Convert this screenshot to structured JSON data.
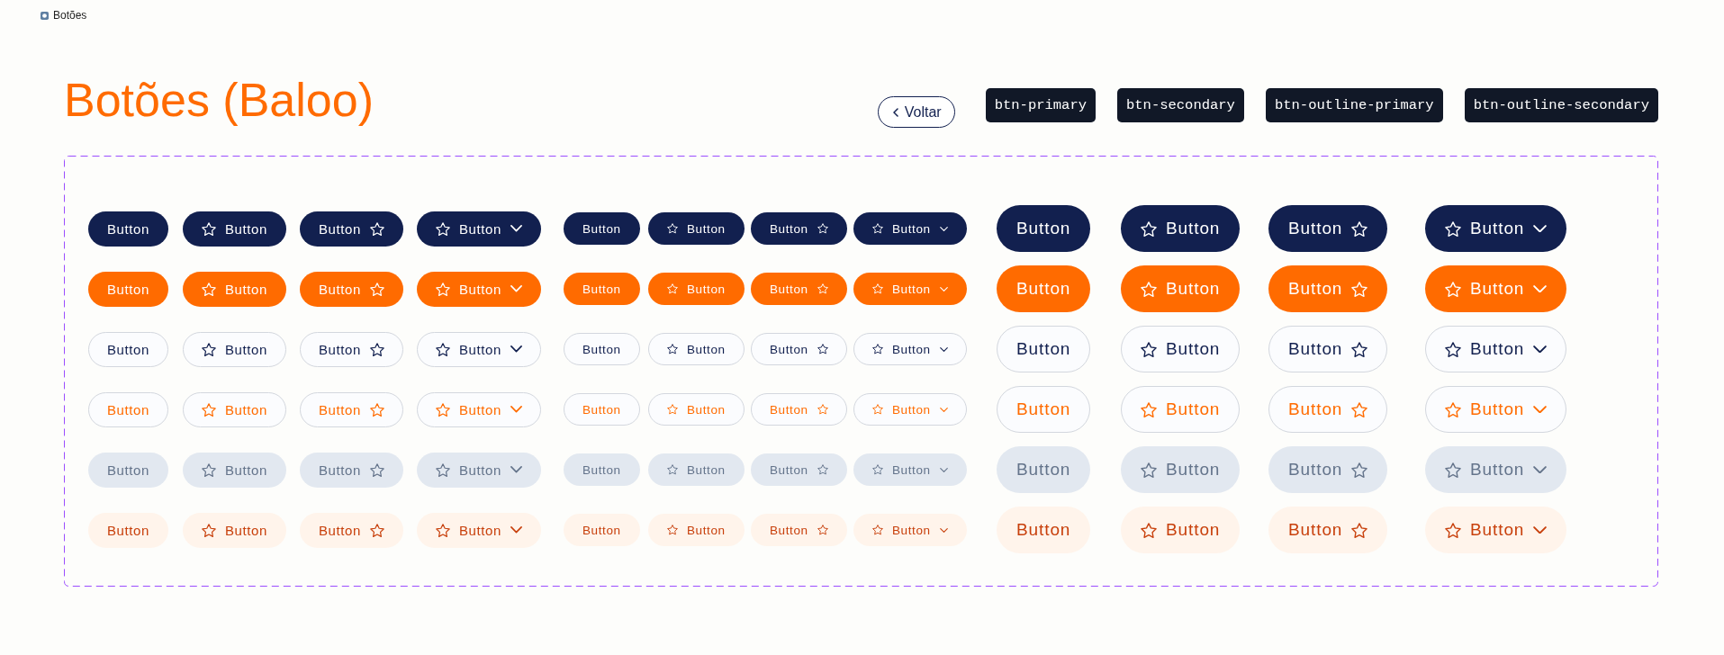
{
  "frame": {
    "title": "Botões"
  },
  "header": {
    "title": "Botões (Baloo)",
    "back_button": {
      "label": "Voltar"
    },
    "class_tags": [
      "btn-primary",
      "btn-secondary",
      "btn-outline-primary",
      "btn-outline-secondary"
    ]
  },
  "button_grid": {
    "rows": [
      {
        "kind": "primary",
        "buttons": [
          {
            "kind": "sm-plain",
            "label": "Button"
          },
          {
            "kind": "sm-icon-left",
            "label": "Button"
          },
          {
            "kind": "sm-icon-right",
            "label": "Button"
          },
          {
            "kind": "sm-dropdown",
            "label": "Button"
          },
          {
            "kind": "xs-plain",
            "label": "Button"
          },
          {
            "kind": "xs-icon-left",
            "label": "Button"
          },
          {
            "kind": "xs-icon-right",
            "label": "Button"
          },
          {
            "kind": "xs-dropdown",
            "label": "Button"
          },
          {
            "kind": "lg-plain",
            "label": "Button"
          },
          {
            "kind": "lg-icon-left",
            "label": "Button"
          },
          {
            "kind": "lg-icon-right",
            "label": "Button"
          },
          {
            "kind": "lg-dropdown",
            "label": "Button"
          }
        ]
      },
      {
        "kind": "secondary",
        "buttons": [
          {
            "kind": "sm-plain",
            "label": "Button"
          },
          {
            "kind": "sm-icon-left",
            "label": "Button"
          },
          {
            "kind": "sm-icon-right",
            "label": "Button"
          },
          {
            "kind": "sm-dropdown",
            "label": "Button"
          },
          {
            "kind": "xs-plain",
            "label": "Button"
          },
          {
            "kind": "xs-icon-left",
            "label": "Button"
          },
          {
            "kind": "xs-icon-right",
            "label": "Button"
          },
          {
            "kind": "xs-dropdown",
            "label": "Button"
          },
          {
            "kind": "lg-plain",
            "label": "Button"
          },
          {
            "kind": "lg-icon-left",
            "label": "Button"
          },
          {
            "kind": "lg-icon-right",
            "label": "Button"
          },
          {
            "kind": "lg-dropdown",
            "label": "Button"
          }
        ]
      },
      {
        "kind": "outline-primary",
        "buttons": [
          {
            "kind": "sm-plain",
            "label": "Button"
          },
          {
            "kind": "sm-icon-left",
            "label": "Button"
          },
          {
            "kind": "sm-icon-right",
            "label": "Button"
          },
          {
            "kind": "sm-dropdown",
            "label": "Button"
          },
          {
            "kind": "xs-plain",
            "label": "Button"
          },
          {
            "kind": "xs-icon-left",
            "label": "Button"
          },
          {
            "kind": "xs-icon-right",
            "label": "Button"
          },
          {
            "kind": "xs-dropdown",
            "label": "Button"
          },
          {
            "kind": "lg-plain",
            "label": "Button"
          },
          {
            "kind": "lg-icon-left",
            "label": "Button"
          },
          {
            "kind": "lg-icon-right",
            "label": "Button"
          },
          {
            "kind": "lg-dropdown",
            "label": "Button"
          }
        ]
      },
      {
        "kind": "outline-secondary",
        "buttons": [
          {
            "kind": "sm-plain",
            "label": "Button"
          },
          {
            "kind": "sm-icon-left",
            "label": "Button"
          },
          {
            "kind": "sm-icon-right",
            "label": "Button"
          },
          {
            "kind": "sm-dropdown",
            "label": "Button"
          },
          {
            "kind": "xs-plain",
            "label": "Button"
          },
          {
            "kind": "xs-icon-left",
            "label": "Button"
          },
          {
            "kind": "xs-icon-right",
            "label": "Button"
          },
          {
            "kind": "xs-dropdown",
            "label": "Button"
          },
          {
            "kind": "lg-plain",
            "label": "Button"
          },
          {
            "kind": "lg-icon-left",
            "label": "Button"
          },
          {
            "kind": "lg-icon-right",
            "label": "Button"
          },
          {
            "kind": "lg-dropdown",
            "label": "Button"
          }
        ]
      },
      {
        "kind": "muted",
        "buttons": [
          {
            "kind": "sm-plain",
            "label": "Button"
          },
          {
            "kind": "sm-icon-left",
            "label": "Button"
          },
          {
            "kind": "sm-icon-right",
            "label": "Button"
          },
          {
            "kind": "sm-dropdown",
            "label": "Button"
          },
          {
            "kind": "xs-plain",
            "label": "Button"
          },
          {
            "kind": "xs-icon-left",
            "label": "Button"
          },
          {
            "kind": "xs-icon-right",
            "label": "Button"
          },
          {
            "kind": "xs-dropdown",
            "label": "Button"
          },
          {
            "kind": "lg-plain",
            "label": "Button"
          },
          {
            "kind": "lg-icon-left",
            "label": "Button"
          },
          {
            "kind": "lg-icon-right",
            "label": "Button"
          },
          {
            "kind": "lg-dropdown",
            "label": "Button"
          }
        ]
      },
      {
        "kind": "tint",
        "buttons": [
          {
            "kind": "sm-plain",
            "label": "Button"
          },
          {
            "kind": "sm-icon-left",
            "label": "Button"
          },
          {
            "kind": "sm-icon-right",
            "label": "Button"
          },
          {
            "kind": "sm-dropdown",
            "label": "Button"
          },
          {
            "kind": "xs-plain",
            "label": "Button"
          },
          {
            "kind": "xs-icon-left",
            "label": "Button"
          },
          {
            "kind": "xs-icon-right",
            "label": "Button"
          },
          {
            "kind": "xs-dropdown",
            "label": "Button"
          },
          {
            "kind": "lg-plain",
            "label": "Button"
          },
          {
            "kind": "lg-icon-left",
            "label": "Button"
          },
          {
            "kind": "lg-icon-right",
            "label": "Button"
          },
          {
            "kind": "lg-dropdown",
            "label": "Button"
          }
        ]
      }
    ]
  }
}
